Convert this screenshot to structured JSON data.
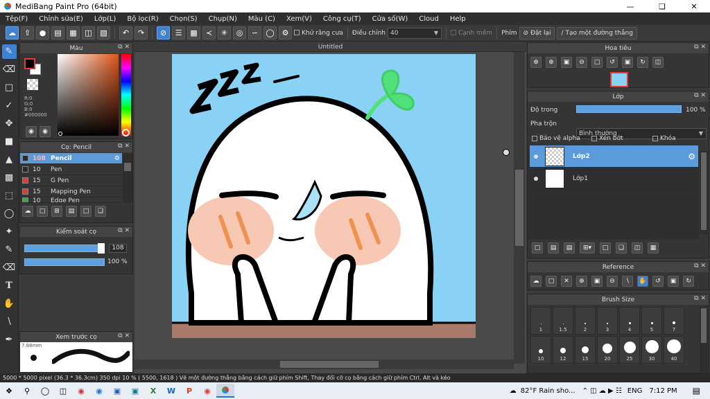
{
  "window": {
    "title": "MediBang Paint Pro (64bit)"
  },
  "menu": [
    "Tệp(F)",
    "Chỉnh sửa(E)",
    "Lớp(L)",
    "Bộ lọc(R)",
    "Chọn(S)",
    "Chụp(N)",
    "Màu (C)",
    "Xem(V)",
    "Công cụ(T)",
    "Cửa số(W)",
    "Cloud",
    "Help"
  ],
  "toolbar": {
    "antialias_label": "Khử răng cưa",
    "adjust_label": "Điều chỉnh",
    "adjust_value": "40",
    "soft_edge_label": "Cạnh mềm",
    "key_label": "Phím",
    "reset_label": "Đặt lại",
    "line_label": "Tạo một đường thẳng"
  },
  "color_panel": {
    "title": "Màu",
    "r": "R:0",
    "g": "G:0",
    "b": "B:0",
    "hex": "#000000"
  },
  "brush_panel": {
    "title": "Cọ: Pencil",
    "items": [
      {
        "size": "108",
        "name": "Pencil",
        "color": "#2b2b2b"
      },
      {
        "size": "10",
        "name": "Pen",
        "color": "#2b2b2b"
      },
      {
        "size": "15",
        "name": "G Pen",
        "color": "#e53935"
      },
      {
        "size": "15",
        "name": "Mapping Pen",
        "color": "#e53935"
      },
      {
        "size": "10",
        "name": "Edge Pen",
        "color": "#43a047"
      }
    ]
  },
  "control_panel": {
    "title": "Kiểm soát cọ",
    "size_value": "108",
    "opacity_value": "100 %",
    "size_level": 0.93,
    "opacity_level": 1.0
  },
  "preview_panel": {
    "title": "Xem trước cọ",
    "size_text": "7.88mm"
  },
  "canvas": {
    "tab_title": "Untitled"
  },
  "nav_panel": {
    "title": "Hoa tiêu"
  },
  "layer_panel": {
    "title": "Lớp",
    "opacity_label": "Độ trong",
    "opacity_value": "100 %",
    "blend_label": "Pha trộn",
    "blend_value": "Bình thường",
    "protect_alpha": "Bảo vệ alpha",
    "clipping": "Xén bớt",
    "lock": "Khóa",
    "layers": [
      {
        "name": "Lớp2",
        "selected": true
      },
      {
        "name": "Lớp1",
        "selected": false
      }
    ]
  },
  "reference_panel": {
    "title": "Reference"
  },
  "brush_size_panel": {
    "title": "Brush Size",
    "sizes": [
      "1",
      "1.5",
      "2",
      "3",
      "4",
      "5",
      "7",
      "10",
      "12",
      "15",
      "20",
      "25",
      "30",
      "40"
    ]
  },
  "status": {
    "text": "5000 * 5000 pixel   (36.3 * 36.3cm)   350 dpi   10 %   ( 5500, 1618 )   Vẽ một đường thẳng bằng cách giữ phím Shift, Thay đổi cỡ cọ bằng cách giữ phím Ctrl, Alt và kéo"
  },
  "taskbar": {
    "weather": "82°F  Rain sho...",
    "lang": "ENG",
    "time": "7:12 PM"
  }
}
